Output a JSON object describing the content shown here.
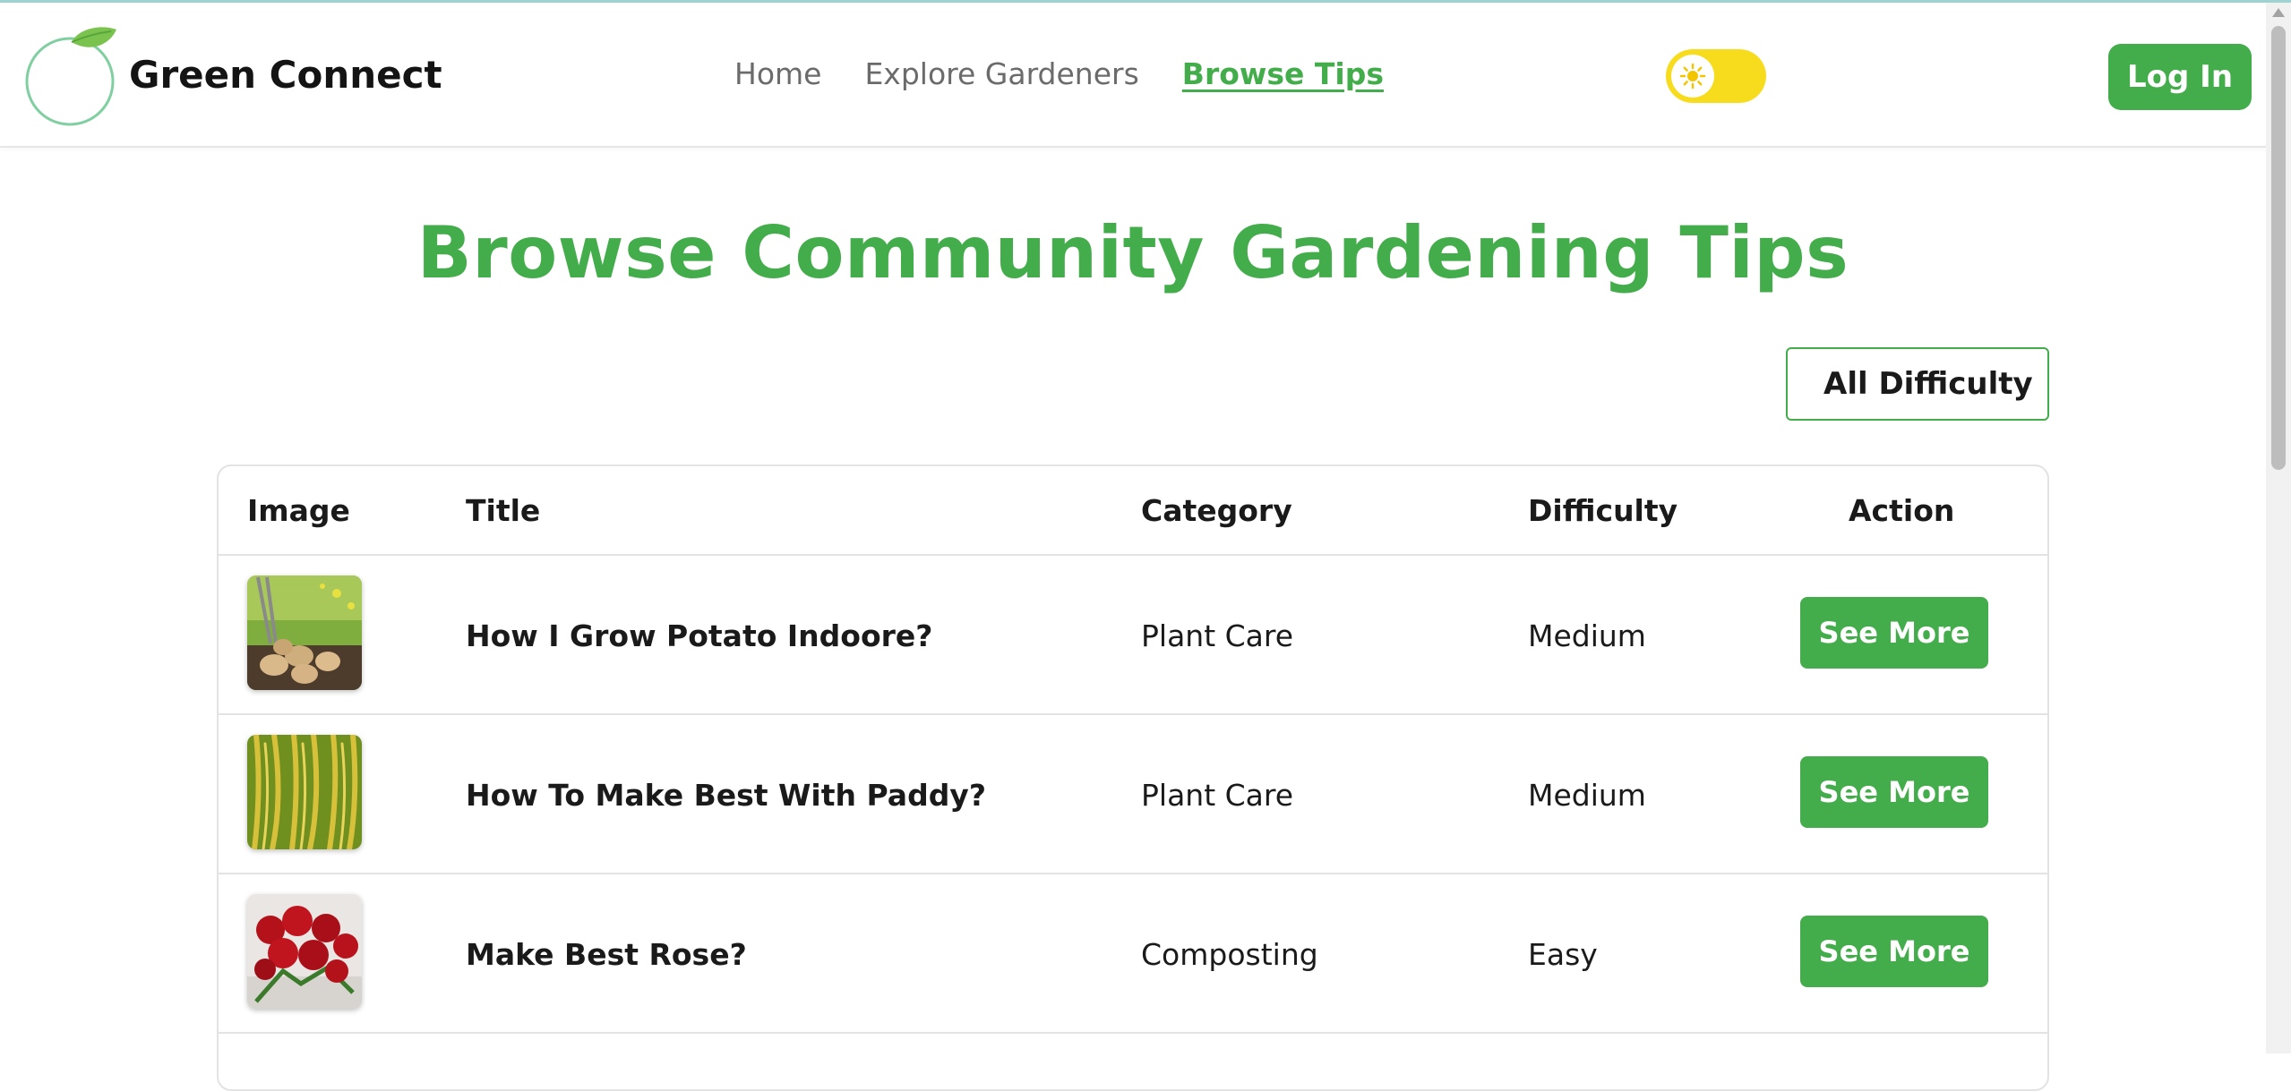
{
  "brand": {
    "name": "Green Connect"
  },
  "nav": {
    "items": [
      {
        "label": "Home"
      },
      {
        "label": "Explore Gardeners"
      },
      {
        "label": "Browse Tips"
      }
    ]
  },
  "theme_toggle": {
    "icon": "sun-icon",
    "color": "#f7dc1e"
  },
  "header": {
    "login_label": "Log In"
  },
  "main": {
    "title": "Browse Community Gardening Tips"
  },
  "filter": {
    "selected": "All Difficulty"
  },
  "table": {
    "headers": [
      "Image",
      "Title",
      "Category",
      "Difficulty",
      "Action"
    ],
    "rows": [
      {
        "image": "potatoes-photo",
        "title": "How I Grow Potato Indoore?",
        "category": "Plant Care",
        "difficulty": "Medium",
        "action": "See More"
      },
      {
        "image": "paddy-photo",
        "title": "How To Make Best With Paddy?",
        "category": "Plant Care",
        "difficulty": "Medium",
        "action": "See More"
      },
      {
        "image": "roses-photo",
        "title": "Make Best Rose?",
        "category": "Composting",
        "difficulty": "Easy",
        "action": "See More"
      }
    ]
  },
  "colors": {
    "accent": "#44ad4b",
    "toggle": "#f7dc1e"
  }
}
